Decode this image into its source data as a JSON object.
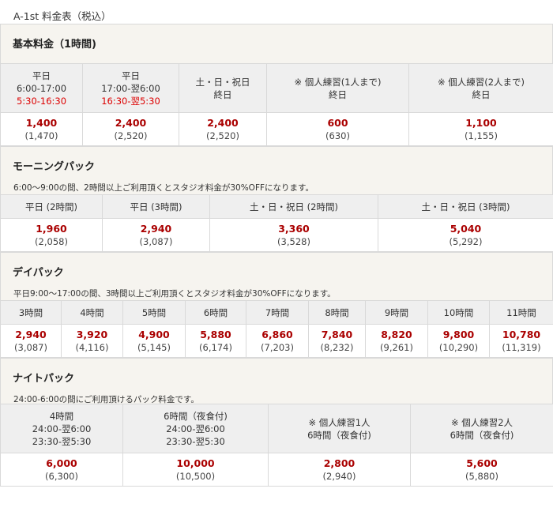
{
  "title": "A-1st 料金表（税込）",
  "basic": {
    "heading": "基本料金（1時間)",
    "headers": [
      {
        "l1": "平日",
        "l2": "6:00-17:00",
        "l3": "5:30-16:30"
      },
      {
        "l1": "平日",
        "l2": "17:00-翌6:00",
        "l3": "16:30-翌5:30"
      },
      {
        "l1": "土・日・祝日",
        "l2": "終日",
        "l3": ""
      },
      {
        "l1": "※ 個人練習(1人まで)",
        "l2": "終日",
        "l3": ""
      },
      {
        "l1": "※ 個人練習(2人まで)",
        "l2": "終日",
        "l3": ""
      }
    ],
    "values": [
      {
        "price": "1,400",
        "tax": "(1,470)"
      },
      {
        "price": "2,400",
        "tax": "(2,520)"
      },
      {
        "price": "2,400",
        "tax": "(2,520)"
      },
      {
        "price": "600",
        "tax": "(630)"
      },
      {
        "price": "1,100",
        "tax": "(1,155)"
      }
    ]
  },
  "morning": {
    "heading": "モーニングパック",
    "desc": "6:00～9:00の間、2時間以上ご利用頂くとスタジオ料金が30%OFFになります。",
    "headers": [
      "平日 (2時間)",
      "平日 (3時間)",
      "土・日・祝日 (2時間)",
      "土・日・祝日 (3時間)"
    ],
    "values": [
      {
        "price": "1,960",
        "tax": "(2,058)"
      },
      {
        "price": "2,940",
        "tax": "(3,087)"
      },
      {
        "price": "3,360",
        "tax": "(3,528)"
      },
      {
        "price": "5,040",
        "tax": "(5,292)"
      }
    ]
  },
  "day": {
    "heading": "デイパック",
    "desc": "平日9:00～17:00の間、3時間以上ご利用頂くとスタジオ料金が30%OFFになります。",
    "headers": [
      "3時間",
      "4時間",
      "5時間",
      "6時間",
      "7時間",
      "8時間",
      "9時間",
      "10時間",
      "11時間"
    ],
    "values": [
      {
        "price": "2,940",
        "tax": "(3,087)"
      },
      {
        "price": "3,920",
        "tax": "(4,116)"
      },
      {
        "price": "4,900",
        "tax": "(5,145)"
      },
      {
        "price": "5,880",
        "tax": "(6,174)"
      },
      {
        "price": "6,860",
        "tax": "(7,203)"
      },
      {
        "price": "7,840",
        "tax": "(8,232)"
      },
      {
        "price": "8,820",
        "tax": "(9,261)"
      },
      {
        "price": "9,800",
        "tax": "(10,290)"
      },
      {
        "price": "10,780",
        "tax": "(11,319)"
      }
    ]
  },
  "night": {
    "heading": "ナイトパック",
    "desc": "24:00-6:00の間にご利用頂けるパック料金です。",
    "headers": [
      {
        "l1": "4時間",
        "l2": "24:00-翌6:00",
        "l3": "23:30-翌5:30"
      },
      {
        "l1": "6時間（夜食付)",
        "l2": "24:00-翌6:00",
        "l3": "23:30-翌5:30"
      },
      {
        "l1": "※ 個人練習1人",
        "l2": "6時間（夜食付)",
        "l3": ""
      },
      {
        "l1": "※ 個人練習2人",
        "l2": "6時間（夜食付)",
        "l3": ""
      }
    ],
    "values": [
      {
        "price": "6,000",
        "tax": "(6,300)"
      },
      {
        "price": "10,000",
        "tax": "(10,500)"
      },
      {
        "price": "2,800",
        "tax": "(2,940)"
      },
      {
        "price": "5,600",
        "tax": "(5,880)"
      }
    ]
  }
}
